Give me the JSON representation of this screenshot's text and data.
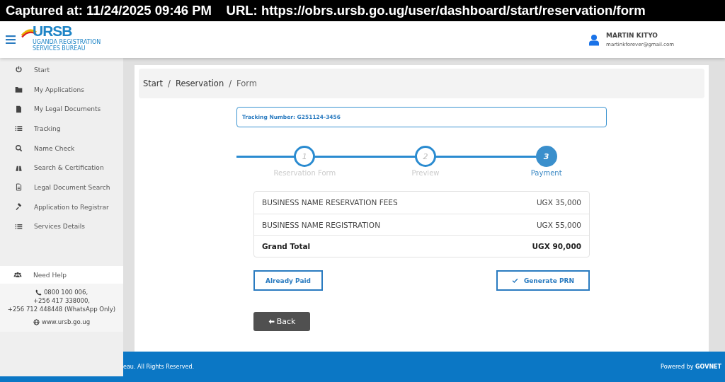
{
  "capture_bar": {
    "text": "Captured at: 11/24/2025 09:46 PM    URL: https://obrs.ursb.go.ug/user/dashboard/start/reservation/form"
  },
  "header": {
    "logo": {
      "title": "URSB",
      "subtitle": "UGANDA REGISTRATION SERVICES BUREAU"
    },
    "user": {
      "name": "MARTIN KITYO",
      "email": "martinkforever@gmail.com"
    }
  },
  "sidebar": {
    "items": [
      {
        "kind": "power",
        "label": "Start"
      },
      {
        "kind": "folder",
        "label": "My Applications"
      },
      {
        "kind": "file",
        "label": "My Legal Documents"
      },
      {
        "kind": "list",
        "label": "Tracking"
      },
      {
        "kind": "search",
        "label": "Name Check"
      },
      {
        "kind": "binoculars",
        "label": "Search & Certification"
      },
      {
        "kind": "document",
        "label": "Legal Document Search"
      },
      {
        "kind": "gavel",
        "label": "Application to Registrar"
      },
      {
        "kind": "list",
        "label": "Services Details"
      }
    ],
    "help": {
      "title": "Need Help",
      "phones": [
        "0800 100 006,",
        "+256 417 338000,",
        "+256 712 448448 (WhatsApp Only)"
      ],
      "website": "www.ursb.go.ug"
    }
  },
  "breadcrumb": [
    "Start",
    "/",
    "Reservation",
    "/",
    "Form"
  ],
  "tracking": {
    "text": "Tracking Number: G251124-3456"
  },
  "steps": [
    {
      "number": "1",
      "label": "Reservation Form",
      "active": false
    },
    {
      "number": "2",
      "label": "Preview",
      "active": false
    },
    {
      "number": "3",
      "label": "Payment",
      "active": true
    }
  ],
  "fees": {
    "rows": [
      {
        "item": "BUSINESS NAME RESERVATION FEES",
        "amount": "UGX 35,000",
        "total": false
      },
      {
        "item": "BUSINESS NAME REGISTRATION",
        "amount": "UGX 55,000",
        "total": false
      },
      {
        "item": "Grand Total",
        "amount": "UGX 90,000",
        "total": true
      }
    ]
  },
  "buttons": {
    "already_paid": "Already Paid",
    "generate": "Generate PRN",
    "back": "Back"
  },
  "footer": {
    "copyright": "eau. All Rights Reserved.",
    "powered_by": "Powered by",
    "brand": "GOVNET"
  }
}
